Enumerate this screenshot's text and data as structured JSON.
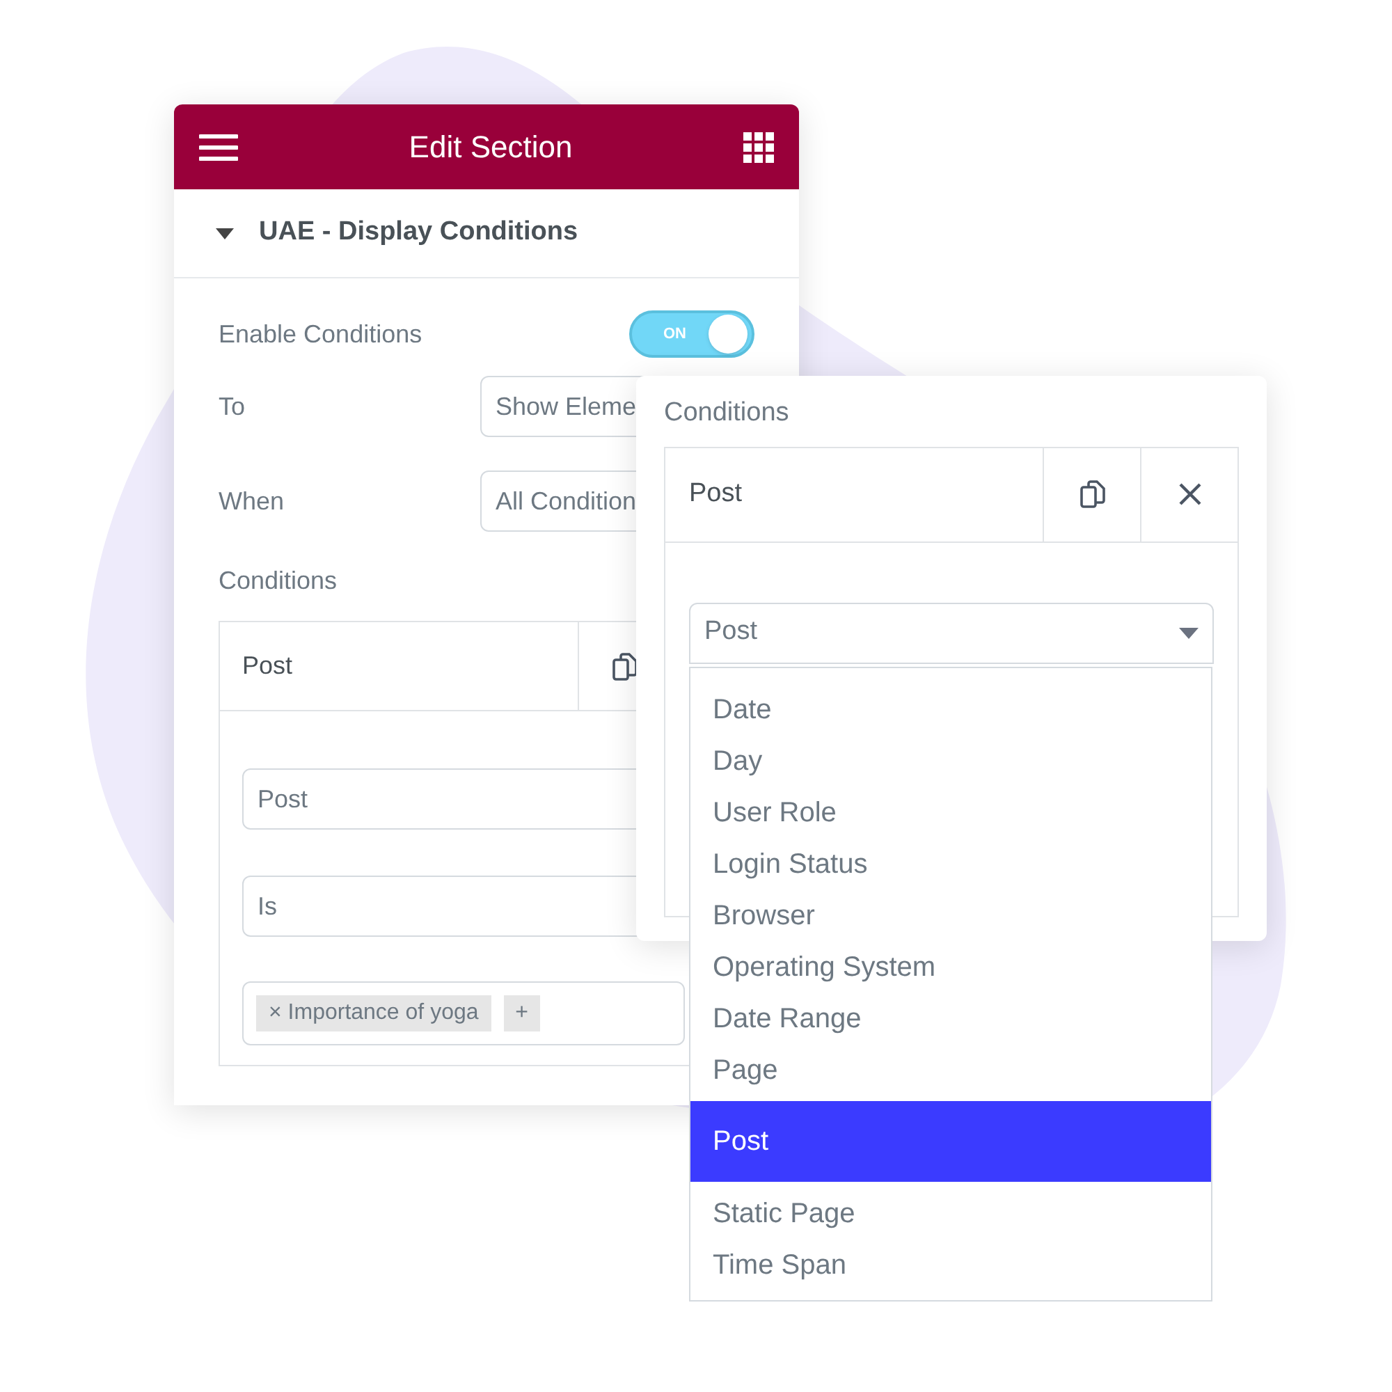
{
  "panel": {
    "title": "Edit Section",
    "section": {
      "title": "UAE - Display Conditions",
      "expanded": true
    },
    "enable": {
      "label": "Enable Conditions",
      "on": true,
      "state_label": "ON"
    },
    "to": {
      "label": "To",
      "value": "Show Eleme"
    },
    "when": {
      "label": "When",
      "value": "All Condition"
    },
    "conditions_label": "Conditions",
    "condition": {
      "title": "Post",
      "type_value": "Post",
      "operator_value": "Is",
      "tags": [
        {
          "remove": "×",
          "label": "Importance of yoga"
        }
      ],
      "add": "+"
    }
  },
  "popup": {
    "label": "Conditions",
    "condition": {
      "title": "Post",
      "select_value": "Post"
    },
    "options": [
      {
        "label": "Date",
        "selected": false
      },
      {
        "label": "Day",
        "selected": false
      },
      {
        "label": "User Role",
        "selected": false
      },
      {
        "label": "Login Status",
        "selected": false
      },
      {
        "label": "Browser",
        "selected": false
      },
      {
        "label": "Operating System",
        "selected": false
      },
      {
        "label": "Date Range",
        "selected": false
      },
      {
        "label": "Page",
        "selected": false
      },
      {
        "label": "Post",
        "selected": true
      },
      {
        "label": "Static Page",
        "selected": false
      },
      {
        "label": "Time Span",
        "selected": false
      }
    ]
  }
}
